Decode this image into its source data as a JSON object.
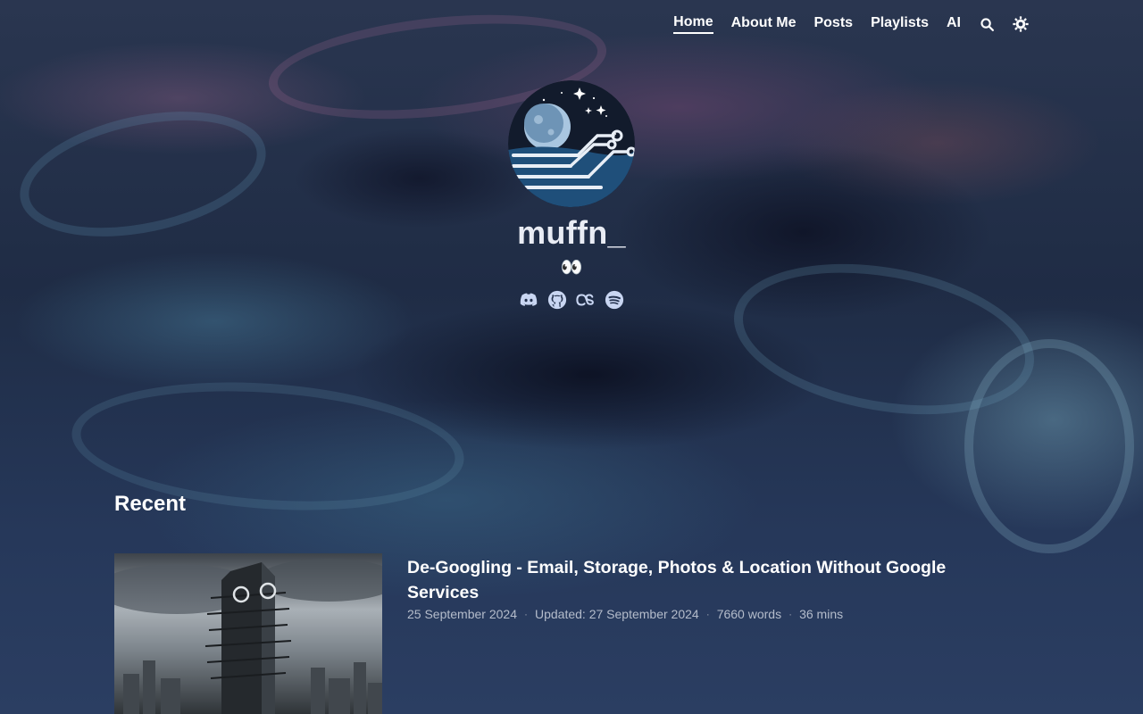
{
  "nav": {
    "items": [
      {
        "label": "Home",
        "active": true
      },
      {
        "label": "About Me",
        "active": false
      },
      {
        "label": "Posts",
        "active": false
      },
      {
        "label": "Playlists",
        "active": false
      },
      {
        "label": "AI",
        "active": false
      }
    ],
    "icons": [
      "search-icon",
      "theme-toggle-icon"
    ]
  },
  "profile": {
    "name": "muffn_",
    "subtitle": "👀",
    "socials": [
      "discord-icon",
      "github-icon",
      "lastfm-icon",
      "spotify-icon"
    ]
  },
  "recent": {
    "heading": "Recent",
    "posts": [
      {
        "title": "De-Googling - Email, Storage, Photos & Location Without Google Services",
        "date": "25 September 2024",
        "updated": "Updated: 27 September 2024",
        "words": "7660 words",
        "reading_time": "36 mins"
      }
    ]
  },
  "colors": {
    "text": "#ffffff",
    "meta": "#b4bccb",
    "social_icon": "#c9d6f2",
    "background": "#24324e"
  }
}
